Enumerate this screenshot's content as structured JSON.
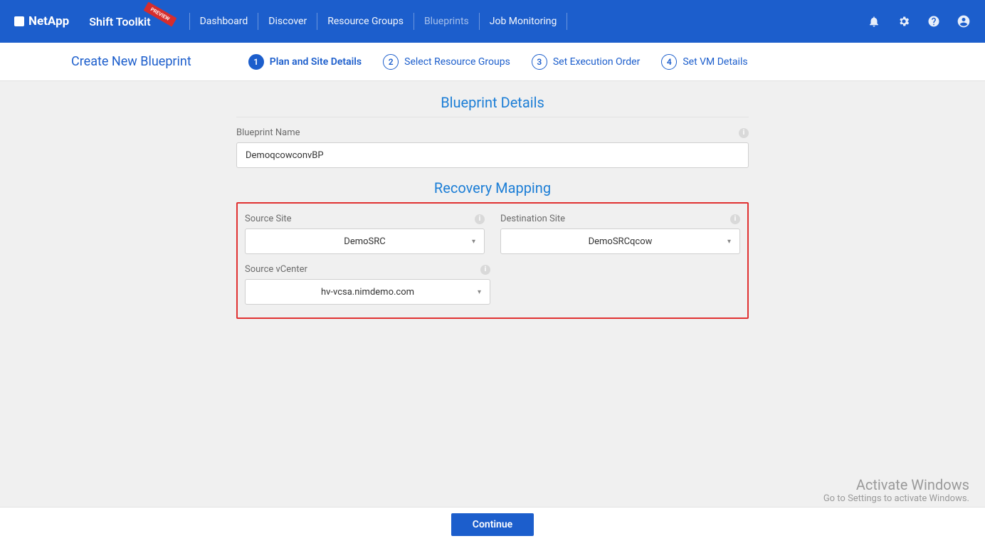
{
  "brand": "NetApp",
  "app_title": "Shift Toolkit",
  "preview_badge": "PREVIEW",
  "nav": {
    "dashboard": "Dashboard",
    "discover": "Discover",
    "resource_groups": "Resource Groups",
    "blueprints": "Blueprints",
    "job_monitoring": "Job Monitoring"
  },
  "wizard": {
    "title": "Create New Blueprint",
    "steps": {
      "s1": "Plan and Site Details",
      "s2": "Select Resource Groups",
      "s3": "Set Execution Order",
      "s4": "Set VM Details"
    }
  },
  "blueprint_details": {
    "heading": "Blueprint Details",
    "name_label": "Blueprint Name",
    "name_value": "DemoqcowconvBP"
  },
  "recovery_mapping": {
    "heading": "Recovery Mapping",
    "source_site_label": "Source Site",
    "source_site_value": "DemoSRC",
    "dest_site_label": "Destination Site",
    "dest_site_value": "DemoSRCqcow",
    "source_vcenter_label": "Source vCenter",
    "source_vcenter_value": "hv-vcsa.nimdemo.com"
  },
  "footer": {
    "continue": "Continue"
  },
  "watermark": {
    "line1": "Activate Windows",
    "line2": "Go to Settings to activate Windows."
  }
}
